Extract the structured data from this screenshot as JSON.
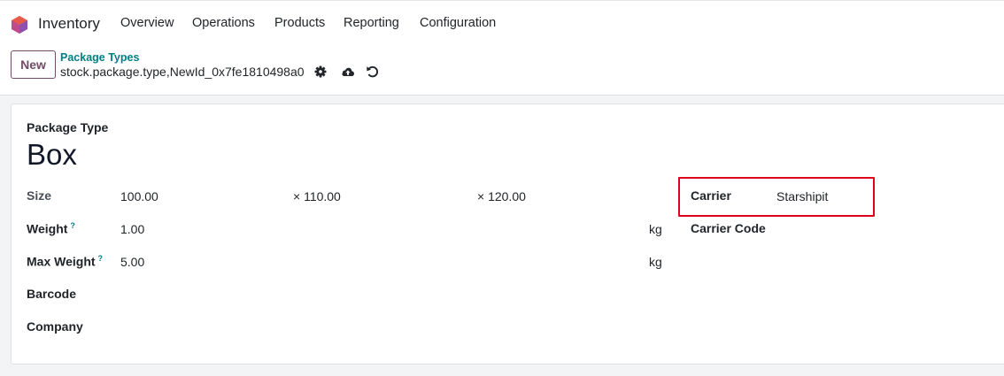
{
  "app": {
    "name": "Inventory"
  },
  "menu": {
    "items": [
      "Overview",
      "Operations",
      "Products",
      "Reporting",
      "Configuration"
    ]
  },
  "controlbar": {
    "new_label": "New",
    "breadcrumb": "Package Types",
    "record_name": "stock.package.type,NewId_0x7fe1810498a0"
  },
  "form": {
    "type_label": "Package Type",
    "type_value": "Box",
    "size": {
      "label": "Size",
      "length": "100.00",
      "width": "× 110.00",
      "height": "× 120.00"
    },
    "weight": {
      "label": "Weight",
      "tooltip": "?",
      "value": "1.00",
      "unit": "kg"
    },
    "max_weight": {
      "label": "Max Weight",
      "tooltip": "?",
      "value": "5.00",
      "unit": "kg"
    },
    "barcode": {
      "label": "Barcode",
      "value": ""
    },
    "company": {
      "label": "Company",
      "value": ""
    },
    "carrier": {
      "label": "Carrier",
      "value": "Starshipit"
    },
    "carrier_code": {
      "label": "Carrier Code",
      "value": ""
    }
  },
  "colors": {
    "brand": "#714b67",
    "link": "#017e84",
    "highlight": "#e0001a"
  }
}
